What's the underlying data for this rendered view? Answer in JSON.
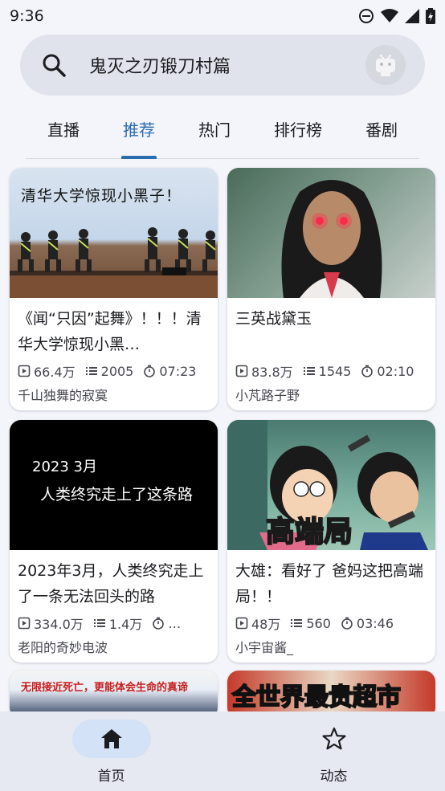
{
  "status_bar": {
    "time": "9:36"
  },
  "search": {
    "query": "鬼灭之刃锻刀村篇"
  },
  "tabs": [
    {
      "label": "直播",
      "active": false
    },
    {
      "label": "推荐",
      "active": true
    },
    {
      "label": "热门",
      "active": false
    },
    {
      "label": "排行榜",
      "active": false
    },
    {
      "label": "番剧",
      "active": false
    }
  ],
  "videos": [
    {
      "thumb_text": "清华大学惊现小黑子！",
      "title": "《闻“只因”起舞》！！！清华大学惊现小黑…",
      "views": "66.4万",
      "danmaku": "2005",
      "duration": "07:23",
      "author": "千山独舞的寂寞"
    },
    {
      "thumb_text": "",
      "title": "三英战黛玉",
      "views": "83.8万",
      "danmaku": "1545",
      "duration": "02:10",
      "author": "小芃路子野"
    },
    {
      "thumb_text_line1": "2023 3月",
      "thumb_text_line2": "人类终究走上了这条路",
      "title": "2023年3月，人类终究走上了一条无法回头的路",
      "views": "334.0万",
      "danmaku": "1.4万",
      "duration": "…",
      "author": "老阳的奇妙电波"
    },
    {
      "thumb_text": "高端局",
      "title": "大雄：看好了 爸妈这把高端局！！",
      "views": "48万",
      "danmaku": "560",
      "duration": "03:46",
      "author": "小宇宙酱_"
    },
    {
      "thumb_text": "无限接近死亡，更能体会生命的真谛"
    },
    {
      "thumb_text": "全世界最贵超市"
    }
  ],
  "bottom_nav": [
    {
      "label": "首页",
      "icon": "home-icon",
      "active": true
    },
    {
      "label": "动态",
      "icon": "star-icon",
      "active": false
    }
  ],
  "colors": {
    "accent": "#2b6cb0",
    "nav_pill": "#d3e2f7",
    "background": "#f3f5fb"
  }
}
